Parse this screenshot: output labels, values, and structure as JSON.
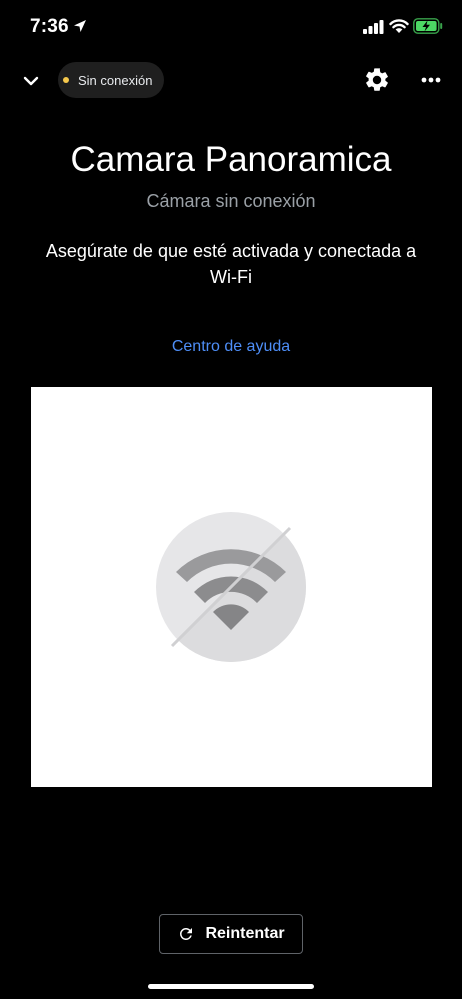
{
  "status_bar": {
    "time": "7:36",
    "location_icon": "location-arrow-icon",
    "signal_icon": "cellular-signal-icon",
    "wifi_icon": "wifi-status-icon",
    "battery_icon": "battery-charging-icon",
    "battery_color": "#4cd964"
  },
  "header": {
    "back_icon": "chevron-down-icon",
    "status_label": "Sin conexión",
    "status_dot_color": "#f5c84c",
    "settings_icon": "gear-icon",
    "more_icon": "more-horizontal-icon"
  },
  "device": {
    "title": "Camara Panoramica",
    "subtitle": "Cámara sin conexión",
    "instructions": "Asegúrate de que esté activada y conectada a Wi-Fi",
    "help_link": "Centro de ayuda",
    "link_color": "#4e8ef7"
  },
  "preview": {
    "icon": "wifi-offline-icon"
  },
  "retry": {
    "label": "Reintentar",
    "icon": "refresh-icon"
  }
}
